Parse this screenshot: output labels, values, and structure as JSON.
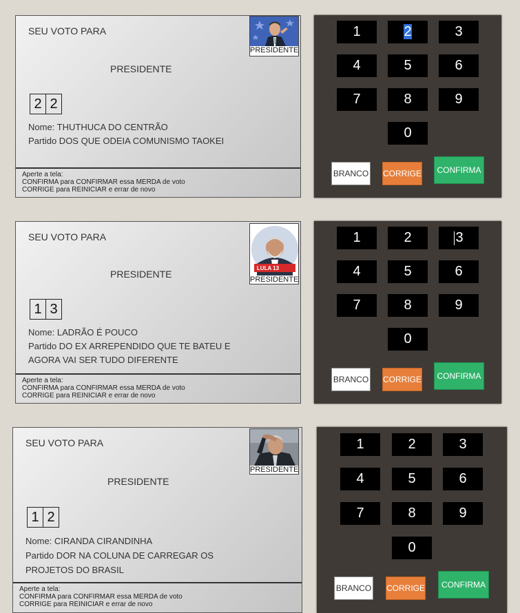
{
  "screens": [
    {
      "seu_voto": "SEU VOTO PARA",
      "cargo": "PRESIDENTE",
      "photo_caption": "PRESIDENTE",
      "photo_icon": "candidate-photo-bolsonaro",
      "digits": [
        "2",
        "2"
      ],
      "nome": "Nome: THUTHUCA DO CENTRÃO",
      "partido_line1": "Partido DOS QUE ODEIA COMUNISMO TAOKEI",
      "partido_line2": "",
      "footer": [
        "Aperte a tela:",
        "CONFIRMA para CONFIRMAR essa MERDA de voto",
        "CORRIGE para REINICIAR e errar de novo"
      ]
    },
    {
      "seu_voto": "SEU VOTO PARA",
      "cargo": "PRESIDENTE",
      "photo_caption": "PRESIDENTE",
      "photo_icon": "candidate-photo-lula",
      "photo_badge": "LULA 13",
      "digits": [
        "1",
        "3"
      ],
      "nome": "Nome: LADRÃO É POUCO",
      "partido_line1": "Partido DO EX ARREPENDIDO QUE TE BATEU E",
      "partido_line2": "AGORA VAI SER TUDO DIFERENTE",
      "footer": [
        "Aperte a tela:",
        "CONFIRMA para CONFIRMAR essa MERDA de voto",
        "CORRIGE para REINICIAR e errar de novo"
      ]
    },
    {
      "seu_voto": "SEU VOTO PARA",
      "cargo": "PRESIDENTE",
      "photo_caption": "PRESIDENTE",
      "photo_icon": "candidate-photo-ciro",
      "digits": [
        "1",
        "2"
      ],
      "nome": "Nome: CIRANDA CIRANDINHA",
      "partido_line1": "Partido DOR NA COLUNA DE CARREGAR OS",
      "partido_line2": "PROJETOS DO BRASIL",
      "footer": [
        "Aperte a tela:",
        "CONFIRMA para CONFIRMAR essa MERDA de voto",
        "CORRIGE para REINICIAR e errar de novo"
      ]
    }
  ],
  "keypad": {
    "keys": [
      "1",
      "2",
      "3",
      "4",
      "5",
      "6",
      "7",
      "8",
      "9",
      "0"
    ],
    "branco": "BRANCO",
    "corrige": "CORRIGE",
    "confirma": "CONFIRMA"
  },
  "colors": {
    "keypad_bg": "#3f3a36",
    "branco": "#ffffff",
    "corrige": "#e77f3b",
    "confirma": "#2fb36a"
  }
}
